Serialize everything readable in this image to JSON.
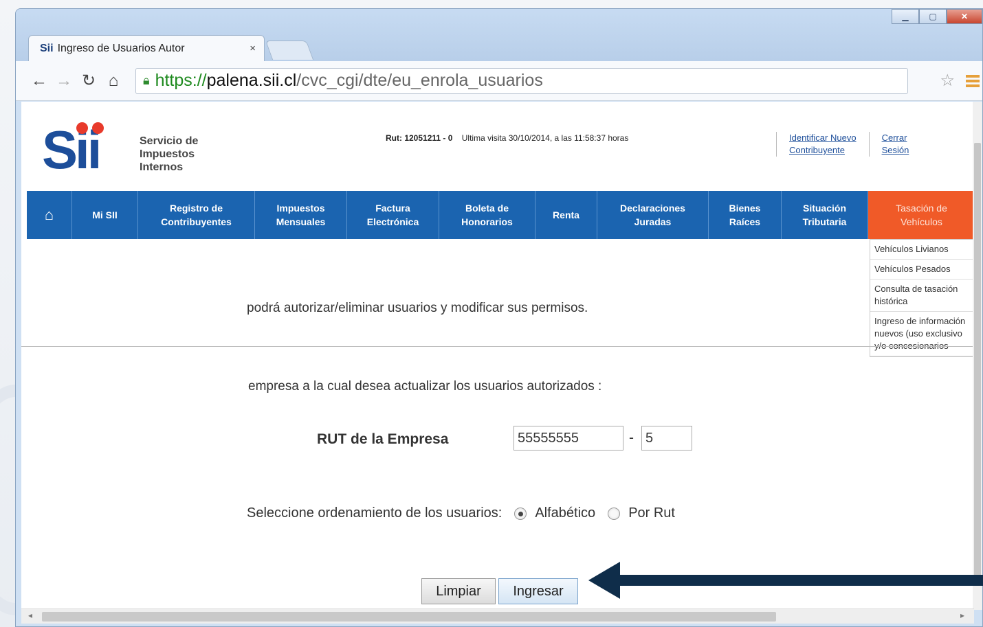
{
  "browser": {
    "tab_title": "Ingreso de Usuarios Autor",
    "tab_logo": "Sii",
    "tab_close": "×",
    "url_scheme": "https://",
    "url_host": "palena.sii.cl",
    "url_path": "/cvc_cgi/dte/eu_enrola_usuarios",
    "icons": [
      "back-icon",
      "forward-icon",
      "reload-icon",
      "home-icon",
      "lock-icon",
      "star-icon",
      "menu-icon"
    ]
  },
  "header": {
    "logo_mark": "Sii",
    "logo_text_1": "Servicio de",
    "logo_text_2": "Impuestos",
    "logo_text_3": "Internos",
    "rut_label": "Rut: 12051211 - 0",
    "last_visit": "Ultima visita 30/10/2014, a las 11:58:37 horas",
    "link_identify_1": "Identificar Nuevo",
    "link_identify_2": "Contribuyente",
    "link_logout_1": "Cerrar",
    "link_logout_2": "Sesión"
  },
  "nav": {
    "mi_sii": "Mi SII",
    "registro_1": "Registro de",
    "registro_2": "Contribuyentes",
    "impuestos_1": "Impuestos",
    "impuestos_2": "Mensuales",
    "factura_1": "Factura",
    "factura_2": "Electrónica",
    "boleta_1": "Boleta de",
    "boleta_2": "Honorarios",
    "renta": "Renta",
    "declaraciones_1": "Declaraciones",
    "declaraciones_2": "Juradas",
    "bienes_1": "Bienes",
    "bienes_2": "Raíces",
    "situacion_1": "Situación",
    "situacion_2": "Tributaria",
    "tasacion_1": "Tasación de",
    "tasacion_2": "Vehículos"
  },
  "dropdown": {
    "item_1": "Vehículos Livianos",
    "item_2": "Vehículos Pesados",
    "item_3a": "Consulta de tasación",
    "item_3b": "histórica",
    "item_4a": "Ingreso de información",
    "item_4b": "nuevos (uso exclusivo",
    "item_4c": "y/o concesionarios"
  },
  "content": {
    "line1": "podrá autorizar/eliminar usuarios y modificar sus permisos.",
    "line2": "empresa a la cual desea actualizar los usuarios autorizados :",
    "rut_label": "RUT de la Empresa",
    "rut_value": "55555555",
    "dash": "-",
    "dv_value": "5",
    "order_label": "Seleccione ordenamiento de los usuarios:",
    "order_alpha": "Alfabético",
    "order_rut": "Por Rut",
    "order_selected": "Alfabético",
    "btn_clear": "Limpiar",
    "btn_submit": "Ingresar"
  },
  "colors": {
    "nav_blue": "#1b64b0",
    "nav_active": "#f05a28",
    "logo_blue": "#1d4e9a",
    "logo_red": "#e83a2b",
    "arrow": "#0f2d4a"
  }
}
